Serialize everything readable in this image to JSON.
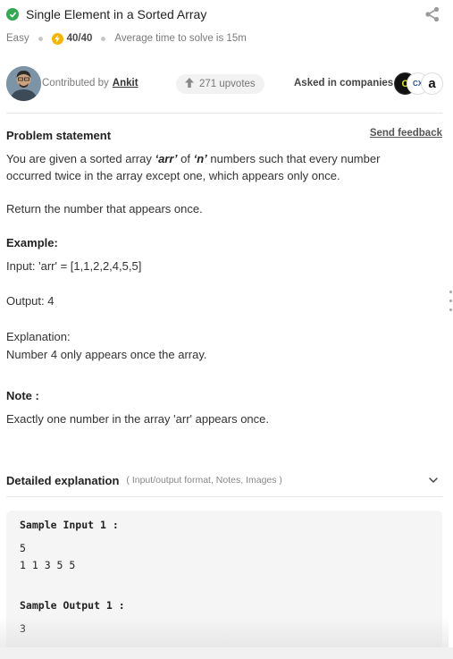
{
  "problem": {
    "title": "Single Element in a Sorted Array",
    "difficulty": "Easy",
    "score": "40/40",
    "avg_time": "Average time to solve is 15m"
  },
  "contributor": {
    "prefix": "Contributed by",
    "name": "Ankit",
    "upvotes": "271 upvotes",
    "asked_label": "Asked in companies"
  },
  "companies": [
    {
      "icon": "codenation-logo",
      "text": "C"
    },
    {
      "icon": "cx-logo",
      "text": "CX"
    },
    {
      "icon": "amazon-logo",
      "text": "a"
    }
  ],
  "statement": {
    "heading": "Problem statement",
    "feedback_link": "Send feedback",
    "p1_a": "You are given a sorted array ",
    "p1_arr": "‘arr’",
    "p1_b": " of ",
    "p1_n": "‘n’",
    "p1_c": " numbers such that every number occurred twice in the array except one, which appears only once.",
    "p2": "Return the number that appears once.",
    "example_label": "Example:",
    "example_input": "Input: 'arr' = [1,1,2,2,4,5,5]",
    "example_output": "Output: 4",
    "explanation_label": "Explanation:",
    "explanation_text": "Number 4 only appears once the array.",
    "note_label": "Note :",
    "note_text": "Exactly one number in the array 'arr' appears once."
  },
  "detailed": {
    "title": "Detailed explanation",
    "subtitle": "( Input/output format, Notes, Images )"
  },
  "samples": {
    "input_label": "Sample Input 1 :",
    "input_line1": "5",
    "input_line2": "1 1 3 5 5",
    "output_label": "Sample Output 1 :",
    "output_line1": "3"
  },
  "colors": {
    "accent_green": "#34a853",
    "score_yellow": "#f4b400"
  }
}
